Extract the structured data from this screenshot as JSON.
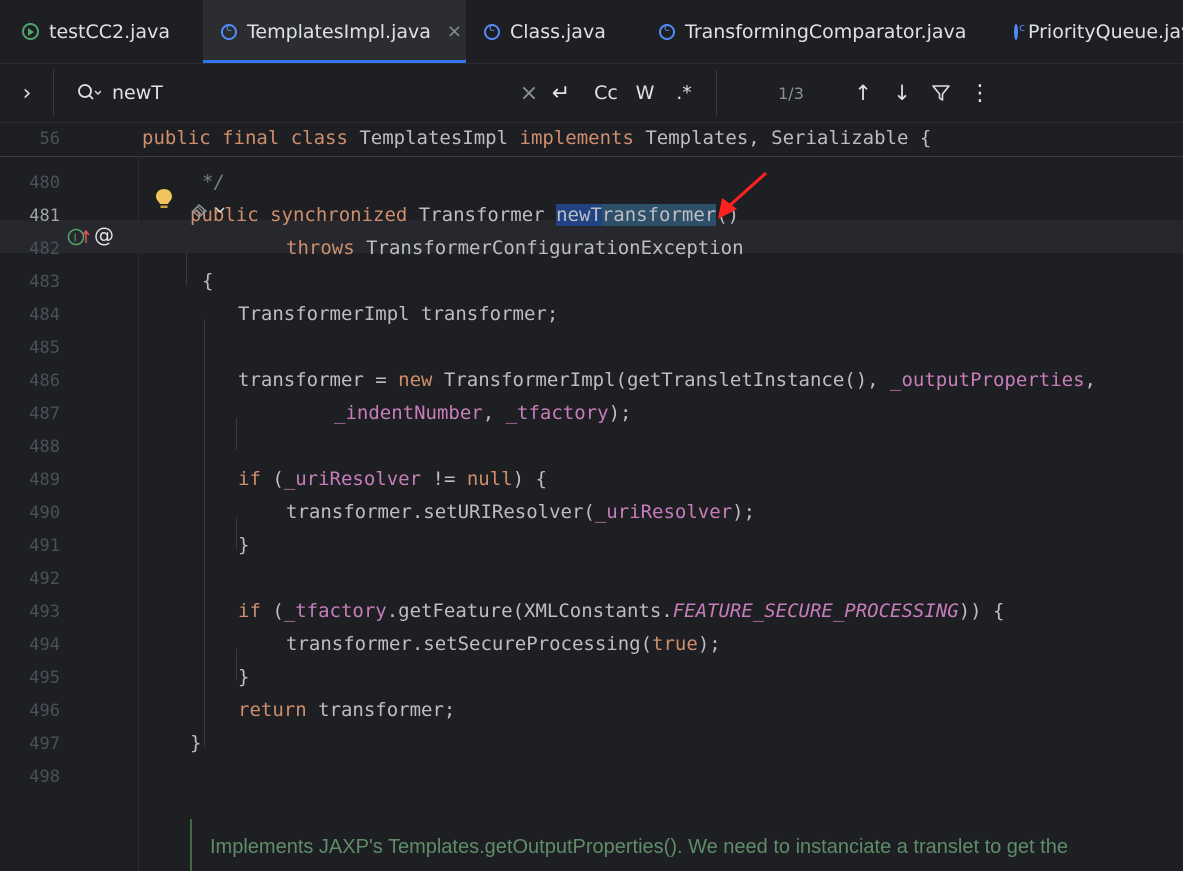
{
  "tabs": [
    {
      "label": "testCC2.java",
      "icon": "run-class-icon",
      "active": false
    },
    {
      "label": "TemplatesImpl.java",
      "icon": "class-icon",
      "active": true,
      "close": "×"
    },
    {
      "label": "Class.java",
      "icon": "class-icon",
      "active": false
    },
    {
      "label": "TransformingComparator.java",
      "icon": "class-icon",
      "active": false
    },
    {
      "label": "PriorityQueue.java",
      "icon": "class-icon",
      "active": false
    }
  ],
  "find": {
    "expand_glyph": "›",
    "search_glyph": "Q",
    "query": "newT",
    "clear_glyph": "×",
    "newline_glyph": "↵",
    "match_case": "Cc",
    "words": "W",
    "regex": ".*",
    "count": "1/3",
    "prev_glyph": "↑",
    "next_glyph": "↓",
    "filter_glyph": "⊽",
    "more_glyph": "⋮"
  },
  "sticky": {
    "line": "56",
    "tokens": [
      {
        "t": "public final class ",
        "c": "kw"
      },
      {
        "t": "TemplatesImpl ",
        "c": ""
      },
      {
        "t": "implements ",
        "c": "kw"
      },
      {
        "t": "Templates, Serializable {",
        "c": ""
      }
    ]
  },
  "lines": [
    {
      "n": "480",
      "indent": 202,
      "tokens": [
        {
          "t": "*/",
          "c": "cmt"
        }
      ]
    },
    {
      "n": "481",
      "indent": 190,
      "cur": true,
      "tokens": [
        {
          "t": "public synchronized ",
          "c": "kw"
        },
        {
          "t": "Transformer ",
          "c": ""
        },
        {
          "t": "newT",
          "c": "hl"
        },
        {
          "t": "ransformer",
          "c": "hl2"
        },
        {
          "t": "()",
          "c": ""
        }
      ]
    },
    {
      "n": "482",
      "indent": 286,
      "tokens": [
        {
          "t": "throws ",
          "c": "kw"
        },
        {
          "t": "TransformerConfigurationException",
          "c": ""
        }
      ]
    },
    {
      "n": "483",
      "indent": 202,
      "tokens": [
        {
          "t": "{",
          "c": ""
        }
      ]
    },
    {
      "n": "484",
      "indent": 238,
      "tokens": [
        {
          "t": "TransformerImpl transformer;",
          "c": ""
        }
      ]
    },
    {
      "n": "485",
      "indent": 238,
      "tokens": []
    },
    {
      "n": "486",
      "indent": 238,
      "tokens": [
        {
          "t": "transformer = ",
          "c": ""
        },
        {
          "t": "new ",
          "c": "kw"
        },
        {
          "t": "TransformerImpl(getTransletInstance(), ",
          "c": ""
        },
        {
          "t": "_outputProperties",
          "c": "fld"
        },
        {
          "t": ",",
          "c": ""
        }
      ]
    },
    {
      "n": "487",
      "indent": 334,
      "tokens": [
        {
          "t": "_indentNumber",
          "c": "fld"
        },
        {
          "t": ", ",
          "c": ""
        },
        {
          "t": "_tfactory",
          "c": "fld"
        },
        {
          "t": ");",
          "c": ""
        }
      ]
    },
    {
      "n": "488",
      "indent": 238,
      "tokens": []
    },
    {
      "n": "489",
      "indent": 238,
      "tokens": [
        {
          "t": "if ",
          "c": "kw"
        },
        {
          "t": "(",
          "c": ""
        },
        {
          "t": "_uriResolver",
          "c": "fld"
        },
        {
          "t": " != ",
          "c": ""
        },
        {
          "t": "null",
          "c": "kw"
        },
        {
          "t": ") {",
          "c": ""
        }
      ]
    },
    {
      "n": "490",
      "indent": 286,
      "tokens": [
        {
          "t": "transformer.setURIResolver(",
          "c": ""
        },
        {
          "t": "_uriResolver",
          "c": "fld"
        },
        {
          "t": ");",
          "c": ""
        }
      ]
    },
    {
      "n": "491",
      "indent": 238,
      "tokens": [
        {
          "t": "}",
          "c": ""
        }
      ]
    },
    {
      "n": "492",
      "indent": 238,
      "tokens": []
    },
    {
      "n": "493",
      "indent": 238,
      "tokens": [
        {
          "t": "if ",
          "c": "kw"
        },
        {
          "t": "(",
          "c": ""
        },
        {
          "t": "_tfactory",
          "c": "fld"
        },
        {
          "t": ".getFeature(XMLConstants.",
          "c": ""
        },
        {
          "t": "FEATURE_SECURE_PROCESSING",
          "c": "cnst"
        },
        {
          "t": ")) {",
          "c": ""
        }
      ]
    },
    {
      "n": "494",
      "indent": 286,
      "tokens": [
        {
          "t": "transformer.setSecureProcessing(",
          "c": ""
        },
        {
          "t": "true",
          "c": "kw"
        },
        {
          "t": ");",
          "c": ""
        }
      ]
    },
    {
      "n": "495",
      "indent": 238,
      "tokens": [
        {
          "t": "}",
          "c": ""
        }
      ]
    },
    {
      "n": "496",
      "indent": 238,
      "tokens": [
        {
          "t": "return ",
          "c": "kw"
        },
        {
          "t": "transformer;",
          "c": ""
        }
      ]
    },
    {
      "n": "497",
      "indent": 190,
      "tokens": [
        {
          "t": "}",
          "c": ""
        }
      ]
    },
    {
      "n": "498",
      "indent": 190,
      "tokens": []
    }
  ],
  "doc": {
    "text": "Implements JAXP's Templates.getOutputProperties(). We need to instanciate a translet to get the"
  },
  "colors": {
    "accent": "#3574f0",
    "search_highlight": "#214283",
    "arrow": "#ff2020"
  }
}
